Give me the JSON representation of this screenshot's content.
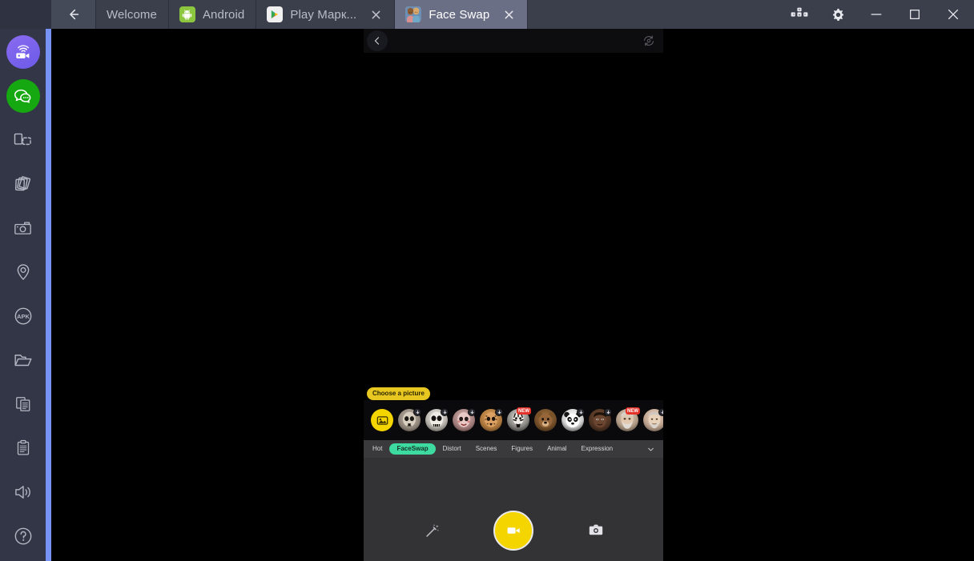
{
  "window": {
    "back_button": "back-arrow-icon",
    "controls": {
      "keymapping": "keymapping-icon",
      "settings": "gear-icon",
      "minimize": "minimize-icon",
      "maximize": "maximize-icon",
      "close": "close-icon"
    }
  },
  "tabs": [
    {
      "label": "Welcome",
      "icon": "none",
      "closable": false,
      "active": false
    },
    {
      "label": "Android",
      "icon": "android",
      "closable": false,
      "active": false
    },
    {
      "label": "Play Марк...",
      "icon": "play",
      "closable": true,
      "active": false
    },
    {
      "label": "Face Swap",
      "icon": "faceswap",
      "closable": true,
      "active": true
    }
  ],
  "sidebar": {
    "items": [
      {
        "name": "screen-record-icon",
        "label": "Record screen"
      },
      {
        "name": "chat-bubble-icon",
        "label": "Chat / WhatsApp"
      },
      {
        "name": "rotate-screen-icon",
        "label": "Rotate screen"
      },
      {
        "name": "multi-window-icon",
        "label": "Multi-instance"
      },
      {
        "name": "screenshot-icon",
        "label": "Screenshot"
      },
      {
        "name": "location-pin-icon",
        "label": "Location"
      },
      {
        "name": "apk-install-icon",
        "label": "Install APK"
      },
      {
        "name": "folder-icon",
        "label": "Shared folder"
      },
      {
        "name": "copy-icon",
        "label": "Copy"
      },
      {
        "name": "clipboard-icon",
        "label": "Clipboard"
      },
      {
        "name": "volume-icon",
        "label": "Volume"
      },
      {
        "name": "help-icon",
        "label": "Help"
      }
    ]
  },
  "app": {
    "name": "Face Swap",
    "topbar": {
      "back": "back-chevron-icon",
      "flip_camera": "flip-camera-icon"
    },
    "tooltip": "Choose a picture",
    "stickers": [
      {
        "name": "choose-picture",
        "glyph": "🖼",
        "badge": "none",
        "type": "choose"
      },
      {
        "name": "skull-mask-1",
        "glyph": "💀",
        "badge": "download"
      },
      {
        "name": "skull-mask-2",
        "glyph": "👻",
        "badge": "download"
      },
      {
        "name": "doll-face-mask",
        "glyph": "🎭",
        "badge": "download"
      },
      {
        "name": "leopard-mask",
        "glyph": "🐆",
        "badge": "download"
      },
      {
        "name": "zebra-mask",
        "glyph": "🦓",
        "badge": "new",
        "badge_text": "NEW"
      },
      {
        "name": "bear-mask",
        "glyph": "🐻",
        "badge": "none"
      },
      {
        "name": "panda-mask",
        "glyph": "🐼",
        "badge": "download"
      },
      {
        "name": "man-face-1",
        "glyph": "👨🏿",
        "badge": "download"
      },
      {
        "name": "old-man-face",
        "glyph": "🧓",
        "badge": "new",
        "badge_text": "NEW"
      },
      {
        "name": "man-face-2",
        "glyph": "👴",
        "badge": "download"
      }
    ],
    "categories": [
      {
        "label": "Hot",
        "active": false
      },
      {
        "label": "FaceSwap",
        "active": true
      },
      {
        "label": "Distort",
        "active": false
      },
      {
        "label": "Scenes",
        "active": false
      },
      {
        "label": "Figures",
        "active": false
      },
      {
        "label": "Animal",
        "active": false
      },
      {
        "label": "Expression",
        "active": false
      }
    ],
    "categories_expand": "chevron-down-icon",
    "controls": {
      "beauty": "magic-wand-icon",
      "record": "video-record-button",
      "mode_toggle": "photo-camera-icon"
    }
  },
  "colors": {
    "titlebar": "#3b3f4c",
    "tab_active": "#6b6f86",
    "sidebar": "#333646",
    "accent_stripe": "#7792f5",
    "record_yellow": "#f4d500",
    "tooltip_yellow": "#e8c820",
    "category_active": "#3ddba0",
    "badge_red": "#e5332a"
  }
}
